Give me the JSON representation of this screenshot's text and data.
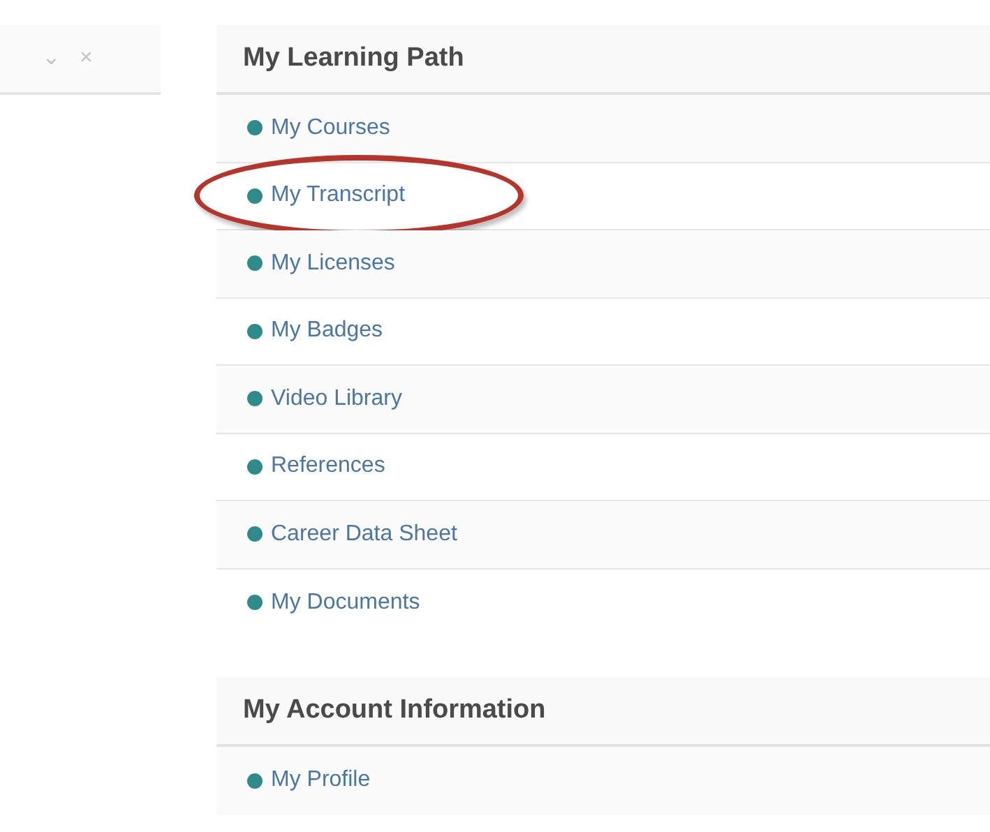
{
  "toolbar": {
    "collapse": "⌄",
    "close": "×"
  },
  "sections": [
    {
      "title": "My Learning Path",
      "items": [
        {
          "label": "My Courses",
          "circled": false
        },
        {
          "label": "My Transcript",
          "circled": true
        },
        {
          "label": "My Licenses",
          "circled": false
        },
        {
          "label": "My Badges",
          "circled": false
        },
        {
          "label": "Video Library",
          "circled": false
        },
        {
          "label": "References",
          "circled": false
        },
        {
          "label": "Career Data Sheet",
          "circled": false
        },
        {
          "label": "My Documents",
          "circled": false
        }
      ]
    },
    {
      "title": "My Account Information",
      "items": [
        {
          "label": "My Profile",
          "circled": false
        }
      ]
    }
  ]
}
